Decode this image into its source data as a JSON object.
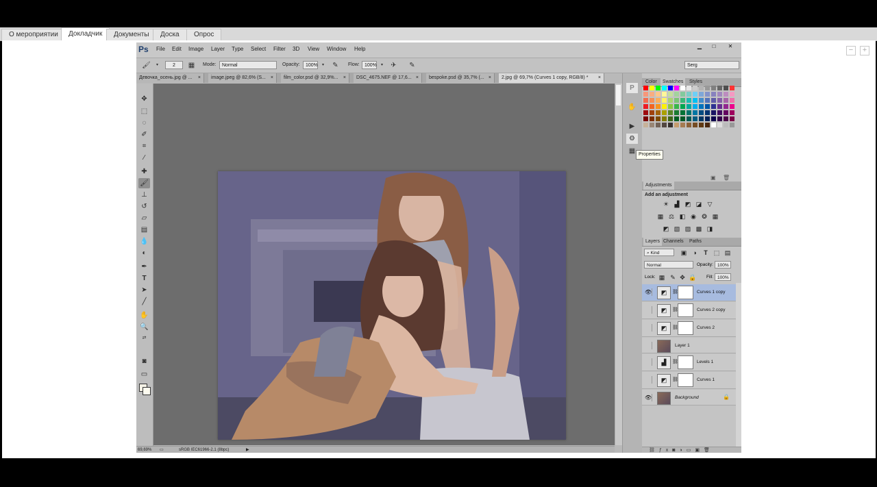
{
  "page_tabs": [
    "О мероприятии",
    "Докладчик",
    "Документы",
    "Доска",
    "Опрос"
  ],
  "active_page_tab": "Докладчик",
  "ps": {
    "logo": "Ps",
    "menu": [
      "File",
      "Edit",
      "Image",
      "Layer",
      "Type",
      "Select",
      "Filter",
      "3D",
      "View",
      "Window",
      "Help"
    ],
    "window_controls": [
      "▁",
      "□",
      "✕"
    ],
    "options": {
      "brush_size": "2",
      "mode_label": "Mode:",
      "mode_value": "Normal",
      "opacity_label": "Opacity:",
      "opacity_value": "100%",
      "flow_label": "Flow:",
      "flow_value": "100%",
      "workspace": "Serg"
    },
    "doc_tabs": [
      "Девочка_осень.jpg @ ...",
      "image.jpeg @ 82,6% (S...",
      "film_color.psd @ 32,9%...",
      "DSC_4675.NEF @ 17,6...",
      "bespoke.psd @ 35,7% (...",
      "2.jpg @ 69,7% (Curves 1 copy, RGB/8) *"
    ],
    "active_doc_tab": 5,
    "status": {
      "zoom": "69,69%",
      "profile": "sRGB IEC61966-2.1 (8bpc)"
    },
    "tooltip": "Properties"
  },
  "panels": {
    "color_tabs": [
      "Color",
      "Swatches",
      "Styles"
    ],
    "active_color_tab": "Swatches",
    "adjustments_tab": "Adjustments",
    "adjustments_header": "Add an adjustment",
    "layers_tabs": [
      "Layers",
      "Channels",
      "Paths"
    ],
    "kind_filter": "Kind",
    "blend_mode": "Normal",
    "opacity_label": "Opacity:",
    "opacity_value": "100%",
    "lock_label": "Lock:",
    "fill_label": "Fill:",
    "fill_value": "100%",
    "layers": [
      {
        "name": "Curves 1 copy",
        "visible": true,
        "selected": true,
        "type": "curves"
      },
      {
        "name": "Curves 2 copy",
        "visible": false,
        "selected": false,
        "type": "curves"
      },
      {
        "name": "Curves 2",
        "visible": false,
        "selected": false,
        "type": "curves"
      },
      {
        "name": "Layer 1",
        "visible": false,
        "selected": false,
        "type": "image"
      },
      {
        "name": "Levels 1",
        "visible": false,
        "selected": false,
        "type": "levels"
      },
      {
        "name": "Curves 1",
        "visible": false,
        "selected": false,
        "type": "curves"
      },
      {
        "name": "Background",
        "visible": true,
        "selected": false,
        "type": "background"
      }
    ]
  },
  "colors": {
    "canvas_bg": "#6d6d6d",
    "ui_bg": "#b9b9b9",
    "selected_layer": "#a7bbdf"
  }
}
